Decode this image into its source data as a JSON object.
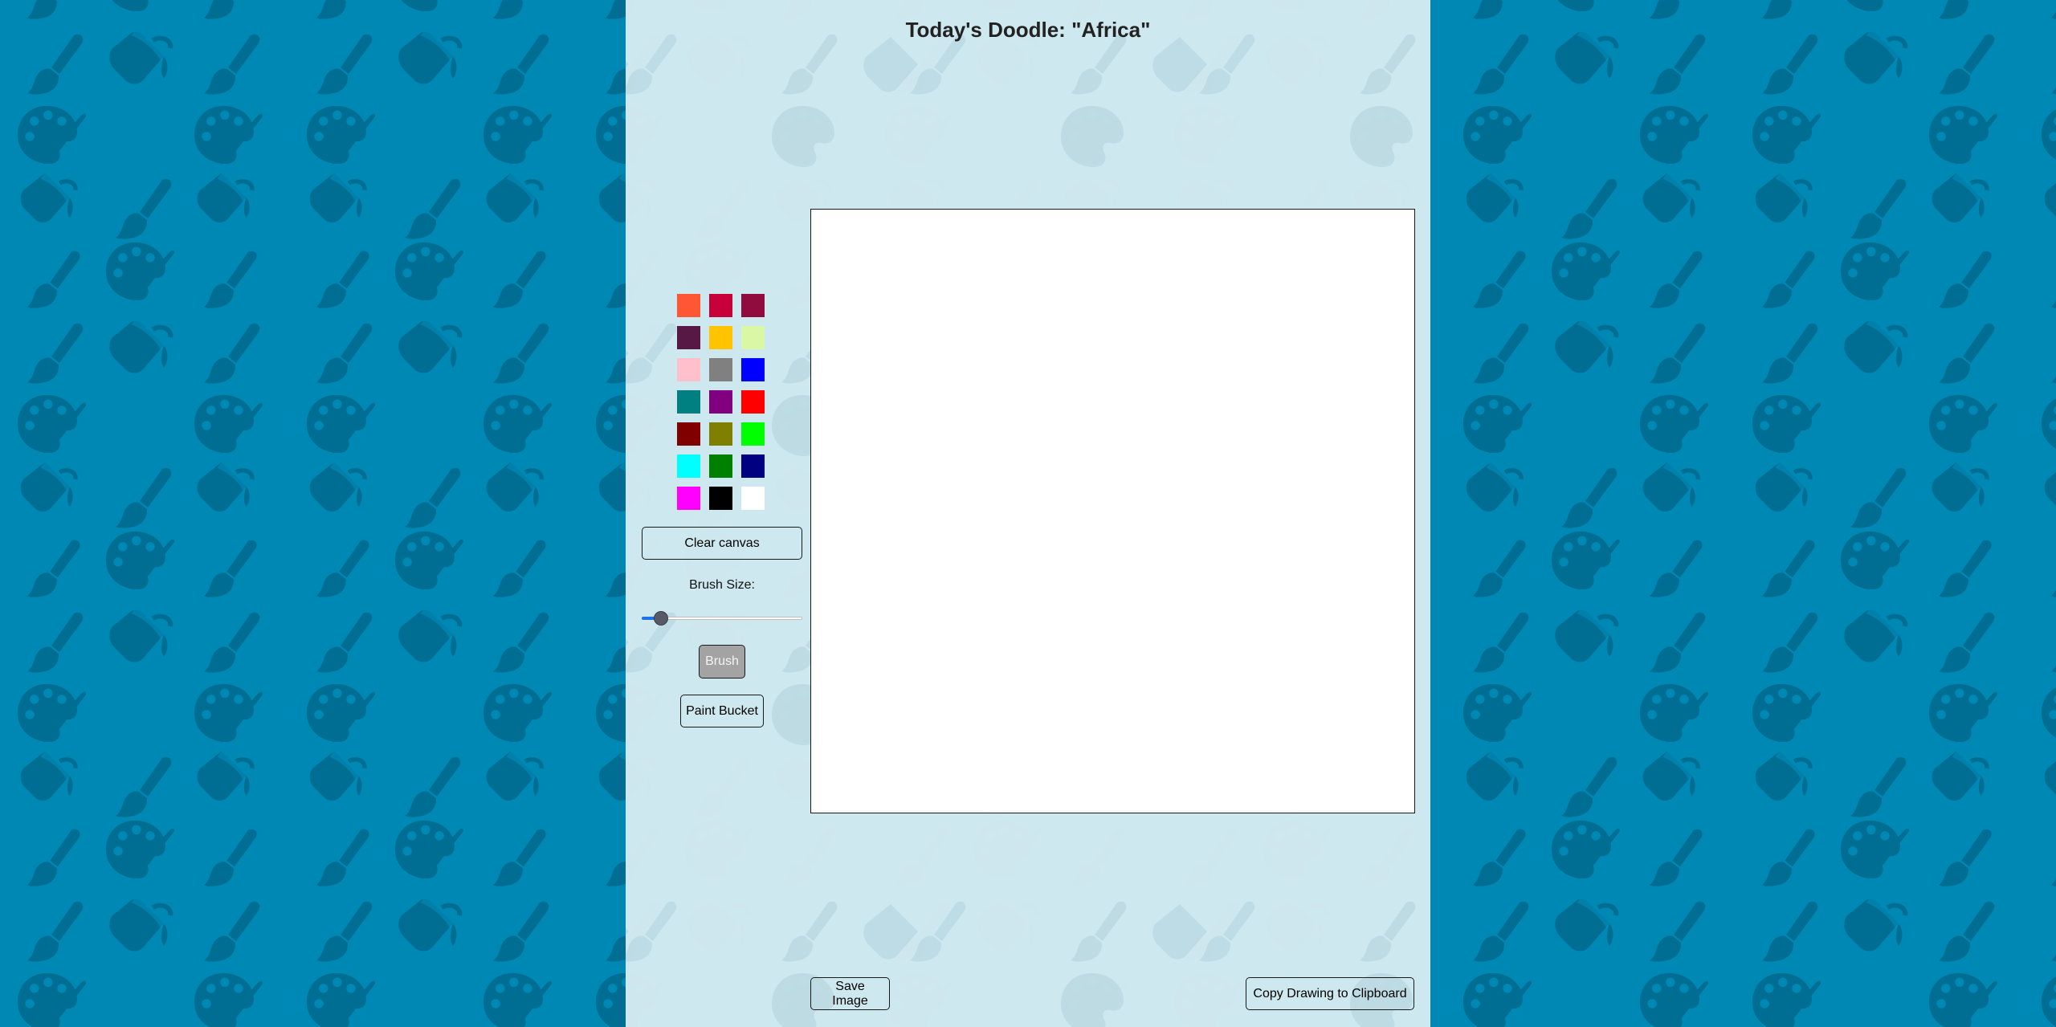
{
  "page": {
    "title": "Today's Doodle: \"Africa\"",
    "background_color": "#0088b5",
    "background_icons": [
      "paintbrush-icon",
      "paint-bucket-icon",
      "palette-icon"
    ]
  },
  "palette": {
    "colors": [
      "#ff5733",
      "#c70039",
      "#900c3f",
      "#581845",
      "#ffc300",
      "#daf7a6",
      "#ffc0cb",
      "#808080",
      "#0000ff",
      "#008080",
      "#800080",
      "#ff0000",
      "#800000",
      "#808000",
      "#00ff00",
      "#00ffff",
      "#008000",
      "#000080",
      "#ff00ff",
      "#000000",
      "#ffffff"
    ]
  },
  "tools": {
    "clear_label": "Clear canvas",
    "brush_size_label": "Brush Size:",
    "brush_size_fraction": 0.08,
    "brush_label": "Brush",
    "bucket_label": "Paint Bucket",
    "active_tool": "brush"
  },
  "actions": {
    "save_label": "Save Image",
    "copy_label": "Copy Drawing to Clipboard"
  }
}
